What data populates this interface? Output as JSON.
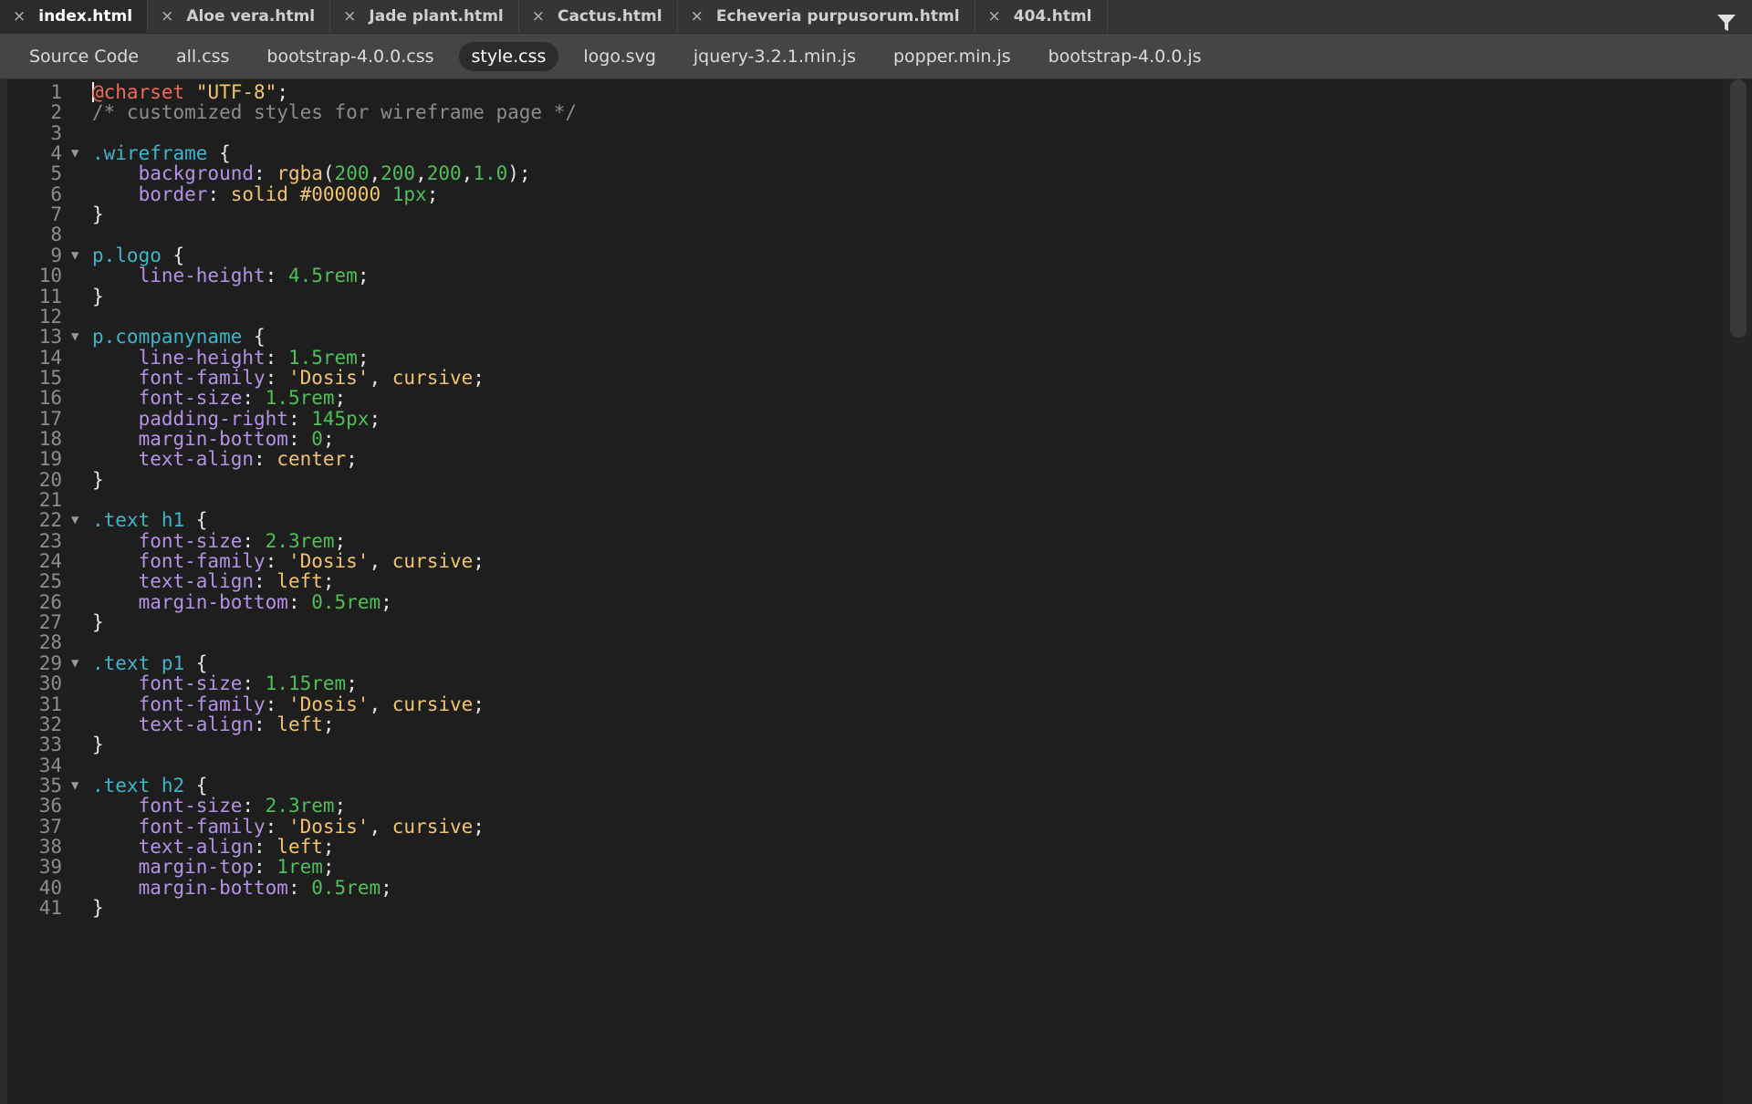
{
  "tabs": [
    {
      "label": "index.html",
      "active": true
    },
    {
      "label": "Aloe vera.html",
      "active": false
    },
    {
      "label": "Jade plant.html",
      "active": false
    },
    {
      "label": "Cactus.html",
      "active": false
    },
    {
      "label": "Echeveria purpusorum.html",
      "active": false
    },
    {
      "label": "404.html",
      "active": false
    }
  ],
  "close_glyph": "×",
  "related_files": [
    {
      "label": "Source Code",
      "active": false
    },
    {
      "label": "all.css",
      "active": false
    },
    {
      "label": "bootstrap-4.0.0.css",
      "active": false
    },
    {
      "label": "style.css",
      "active": true
    },
    {
      "label": "logo.svg",
      "active": false
    },
    {
      "label": "jquery-3.2.1.min.js",
      "active": false
    },
    {
      "label": "popper.min.js",
      "active": false
    },
    {
      "label": "bootstrap-4.0.0.js",
      "active": false
    }
  ],
  "filter_icon": "funnel-icon",
  "colors": {
    "at_rule": "#ef6a5a",
    "string": "#f2c46d",
    "comment": "#8c8c8c",
    "selector": "#3fb5c9",
    "property": "#b592e6",
    "number": "#4fbf57",
    "value": "#f2c46d",
    "background": "#1e1e1e"
  },
  "code_lines": [
    {
      "n": "1",
      "fold": false,
      "tokens": [
        [
          "at",
          "@charset"
        ],
        [
          "punc",
          " "
        ],
        [
          "str",
          "\"UTF-8\""
        ],
        [
          "punc",
          ";"
        ]
      ]
    },
    {
      "n": "2",
      "fold": false,
      "tokens": [
        [
          "com",
          "/* customized styles for wireframe page */"
        ]
      ]
    },
    {
      "n": "3",
      "fold": false,
      "tokens": []
    },
    {
      "n": "4",
      "fold": true,
      "tokens": [
        [
          "sel",
          ".wireframe"
        ],
        [
          "punc",
          " {"
        ]
      ]
    },
    {
      "n": "5",
      "fold": false,
      "tokens": [
        [
          "punc",
          "    "
        ],
        [
          "prop",
          "background"
        ],
        [
          "punc",
          ": "
        ],
        [
          "val",
          "rgba"
        ],
        [
          "punc",
          "("
        ],
        [
          "num",
          "200"
        ],
        [
          "punc",
          ","
        ],
        [
          "num",
          "200"
        ],
        [
          "punc",
          ","
        ],
        [
          "num",
          "200"
        ],
        [
          "punc",
          ","
        ],
        [
          "num",
          "1.0"
        ],
        [
          "punc",
          ");"
        ]
      ]
    },
    {
      "n": "6",
      "fold": false,
      "tokens": [
        [
          "punc",
          "    "
        ],
        [
          "prop",
          "border"
        ],
        [
          "punc",
          ": "
        ],
        [
          "val",
          "solid #000000"
        ],
        [
          "punc",
          " "
        ],
        [
          "num",
          "1px"
        ],
        [
          "punc",
          ";"
        ]
      ]
    },
    {
      "n": "7",
      "fold": false,
      "tokens": [
        [
          "punc",
          "}"
        ]
      ]
    },
    {
      "n": "8",
      "fold": false,
      "tokens": []
    },
    {
      "n": "9",
      "fold": true,
      "tokens": [
        [
          "sel",
          "p.logo"
        ],
        [
          "punc",
          " {"
        ]
      ]
    },
    {
      "n": "10",
      "fold": false,
      "tokens": [
        [
          "punc",
          "    "
        ],
        [
          "prop",
          "line-height"
        ],
        [
          "punc",
          ": "
        ],
        [
          "num",
          "4.5rem"
        ],
        [
          "punc",
          ";"
        ]
      ]
    },
    {
      "n": "11",
      "fold": false,
      "tokens": [
        [
          "punc",
          "}"
        ]
      ]
    },
    {
      "n": "12",
      "fold": false,
      "tokens": []
    },
    {
      "n": "13",
      "fold": true,
      "tokens": [
        [
          "sel",
          "p.companyname"
        ],
        [
          "punc",
          " {"
        ]
      ]
    },
    {
      "n": "14",
      "fold": false,
      "tokens": [
        [
          "punc",
          "    "
        ],
        [
          "prop",
          "line-height"
        ],
        [
          "punc",
          ": "
        ],
        [
          "num",
          "1.5rem"
        ],
        [
          "punc",
          ";"
        ]
      ]
    },
    {
      "n": "15",
      "fold": false,
      "tokens": [
        [
          "punc",
          "    "
        ],
        [
          "prop",
          "font-family"
        ],
        [
          "punc",
          ": "
        ],
        [
          "str",
          "'Dosis'"
        ],
        [
          "punc",
          ", "
        ],
        [
          "val",
          "cursive"
        ],
        [
          "punc",
          ";"
        ]
      ]
    },
    {
      "n": "16",
      "fold": false,
      "tokens": [
        [
          "punc",
          "    "
        ],
        [
          "prop",
          "font-size"
        ],
        [
          "punc",
          ": "
        ],
        [
          "num",
          "1.5rem"
        ],
        [
          "punc",
          ";"
        ]
      ]
    },
    {
      "n": "17",
      "fold": false,
      "tokens": [
        [
          "punc",
          "    "
        ],
        [
          "prop",
          "padding-right"
        ],
        [
          "punc",
          ": "
        ],
        [
          "num",
          "145px"
        ],
        [
          "punc",
          ";"
        ]
      ]
    },
    {
      "n": "18",
      "fold": false,
      "tokens": [
        [
          "punc",
          "    "
        ],
        [
          "prop",
          "margin-bottom"
        ],
        [
          "punc",
          ": "
        ],
        [
          "num",
          "0"
        ],
        [
          "punc",
          ";"
        ]
      ]
    },
    {
      "n": "19",
      "fold": false,
      "tokens": [
        [
          "punc",
          "    "
        ],
        [
          "prop",
          "text-align"
        ],
        [
          "punc",
          ": "
        ],
        [
          "val",
          "center"
        ],
        [
          "punc",
          ";"
        ]
      ]
    },
    {
      "n": "20",
      "fold": false,
      "tokens": [
        [
          "punc",
          "}"
        ]
      ]
    },
    {
      "n": "21",
      "fold": false,
      "tokens": []
    },
    {
      "n": "22",
      "fold": true,
      "tokens": [
        [
          "sel",
          ".text h1"
        ],
        [
          "punc",
          " {"
        ]
      ]
    },
    {
      "n": "23",
      "fold": false,
      "tokens": [
        [
          "punc",
          "    "
        ],
        [
          "prop",
          "font-size"
        ],
        [
          "punc",
          ": "
        ],
        [
          "num",
          "2.3rem"
        ],
        [
          "punc",
          ";"
        ]
      ]
    },
    {
      "n": "24",
      "fold": false,
      "tokens": [
        [
          "punc",
          "    "
        ],
        [
          "prop",
          "font-family"
        ],
        [
          "punc",
          ": "
        ],
        [
          "str",
          "'Dosis'"
        ],
        [
          "punc",
          ", "
        ],
        [
          "val",
          "cursive"
        ],
        [
          "punc",
          ";"
        ]
      ]
    },
    {
      "n": "25",
      "fold": false,
      "tokens": [
        [
          "punc",
          "    "
        ],
        [
          "prop",
          "text-align"
        ],
        [
          "punc",
          ": "
        ],
        [
          "val",
          "left"
        ],
        [
          "punc",
          ";"
        ]
      ]
    },
    {
      "n": "26",
      "fold": false,
      "tokens": [
        [
          "punc",
          "    "
        ],
        [
          "prop",
          "margin-bottom"
        ],
        [
          "punc",
          ": "
        ],
        [
          "num",
          "0.5rem"
        ],
        [
          "punc",
          ";"
        ]
      ]
    },
    {
      "n": "27",
      "fold": false,
      "tokens": [
        [
          "punc",
          "}"
        ]
      ]
    },
    {
      "n": "28",
      "fold": false,
      "tokens": []
    },
    {
      "n": "29",
      "fold": true,
      "tokens": [
        [
          "sel",
          ".text p1"
        ],
        [
          "punc",
          " {"
        ]
      ]
    },
    {
      "n": "30",
      "fold": false,
      "tokens": [
        [
          "punc",
          "    "
        ],
        [
          "prop",
          "font-size"
        ],
        [
          "punc",
          ": "
        ],
        [
          "num",
          "1.15rem"
        ],
        [
          "punc",
          ";"
        ]
      ]
    },
    {
      "n": "31",
      "fold": false,
      "tokens": [
        [
          "punc",
          "    "
        ],
        [
          "prop",
          "font-family"
        ],
        [
          "punc",
          ": "
        ],
        [
          "str",
          "'Dosis'"
        ],
        [
          "punc",
          ", "
        ],
        [
          "val",
          "cursive"
        ],
        [
          "punc",
          ";"
        ]
      ]
    },
    {
      "n": "32",
      "fold": false,
      "tokens": [
        [
          "punc",
          "    "
        ],
        [
          "prop",
          "text-align"
        ],
        [
          "punc",
          ": "
        ],
        [
          "val",
          "left"
        ],
        [
          "punc",
          ";"
        ]
      ]
    },
    {
      "n": "33",
      "fold": false,
      "tokens": [
        [
          "punc",
          "}"
        ]
      ]
    },
    {
      "n": "34",
      "fold": false,
      "tokens": []
    },
    {
      "n": "35",
      "fold": true,
      "tokens": [
        [
          "sel",
          ".text h2"
        ],
        [
          "punc",
          " {"
        ]
      ]
    },
    {
      "n": "36",
      "fold": false,
      "tokens": [
        [
          "punc",
          "    "
        ],
        [
          "prop",
          "font-size"
        ],
        [
          "punc",
          ": "
        ],
        [
          "num",
          "2.3rem"
        ],
        [
          "punc",
          ";"
        ]
      ]
    },
    {
      "n": "37",
      "fold": false,
      "tokens": [
        [
          "punc",
          "    "
        ],
        [
          "prop",
          "font-family"
        ],
        [
          "punc",
          ": "
        ],
        [
          "str",
          "'Dosis'"
        ],
        [
          "punc",
          ", "
        ],
        [
          "val",
          "cursive"
        ],
        [
          "punc",
          ";"
        ]
      ]
    },
    {
      "n": "38",
      "fold": false,
      "tokens": [
        [
          "punc",
          "    "
        ],
        [
          "prop",
          "text-align"
        ],
        [
          "punc",
          ": "
        ],
        [
          "val",
          "left"
        ],
        [
          "punc",
          ";"
        ]
      ]
    },
    {
      "n": "39",
      "fold": false,
      "tokens": [
        [
          "punc",
          "    "
        ],
        [
          "prop",
          "margin-top"
        ],
        [
          "punc",
          ": "
        ],
        [
          "num",
          "1rem"
        ],
        [
          "punc",
          ";"
        ]
      ]
    },
    {
      "n": "40",
      "fold": false,
      "tokens": [
        [
          "punc",
          "    "
        ],
        [
          "prop",
          "margin-bottom"
        ],
        [
          "punc",
          ": "
        ],
        [
          "num",
          "0.5rem"
        ],
        [
          "punc",
          ";"
        ]
      ]
    },
    {
      "n": "41",
      "fold": false,
      "tokens": [
        [
          "punc",
          "}"
        ]
      ]
    }
  ]
}
